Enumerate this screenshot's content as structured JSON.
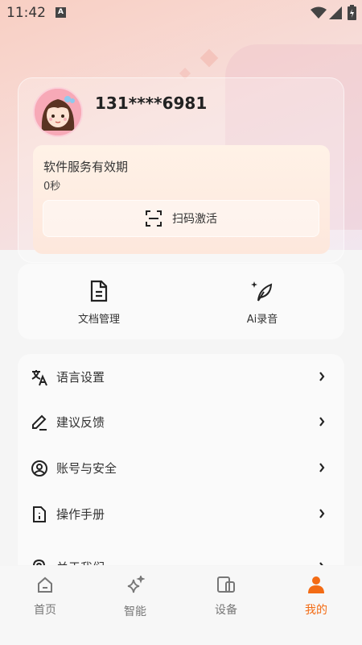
{
  "status_bar": {
    "time": "11:42",
    "notification_icon": "A"
  },
  "profile": {
    "phone": "131****6981"
  },
  "service": {
    "title": "软件服务有效期",
    "value": "0秒",
    "scan_button": "扫码激活"
  },
  "tools": [
    {
      "label": "文档管理",
      "icon": "document-icon"
    },
    {
      "label": "Ai录音",
      "icon": "feather-pen-icon"
    }
  ],
  "menu": [
    {
      "label": "语言设置",
      "icon": "translate-icon"
    },
    {
      "label": "建议反馈",
      "icon": "pen-icon"
    },
    {
      "label": "账号与安全",
      "icon": "account-icon"
    },
    {
      "label": "操作手册",
      "icon": "manual-icon"
    },
    {
      "label": "关于我们",
      "icon": "touch-icon"
    }
  ],
  "tabs": [
    {
      "label": "首页",
      "icon": "home-icon",
      "active": false
    },
    {
      "label": "智能",
      "icon": "sparkle-icon",
      "active": false
    },
    {
      "label": "设备",
      "icon": "devices-icon",
      "active": false
    },
    {
      "label": "我的",
      "icon": "person-icon",
      "active": true
    }
  ],
  "colors": {
    "accent": "#f36b14",
    "hero_top": "#f8cfc3",
    "card_bg": "#fafafa"
  }
}
